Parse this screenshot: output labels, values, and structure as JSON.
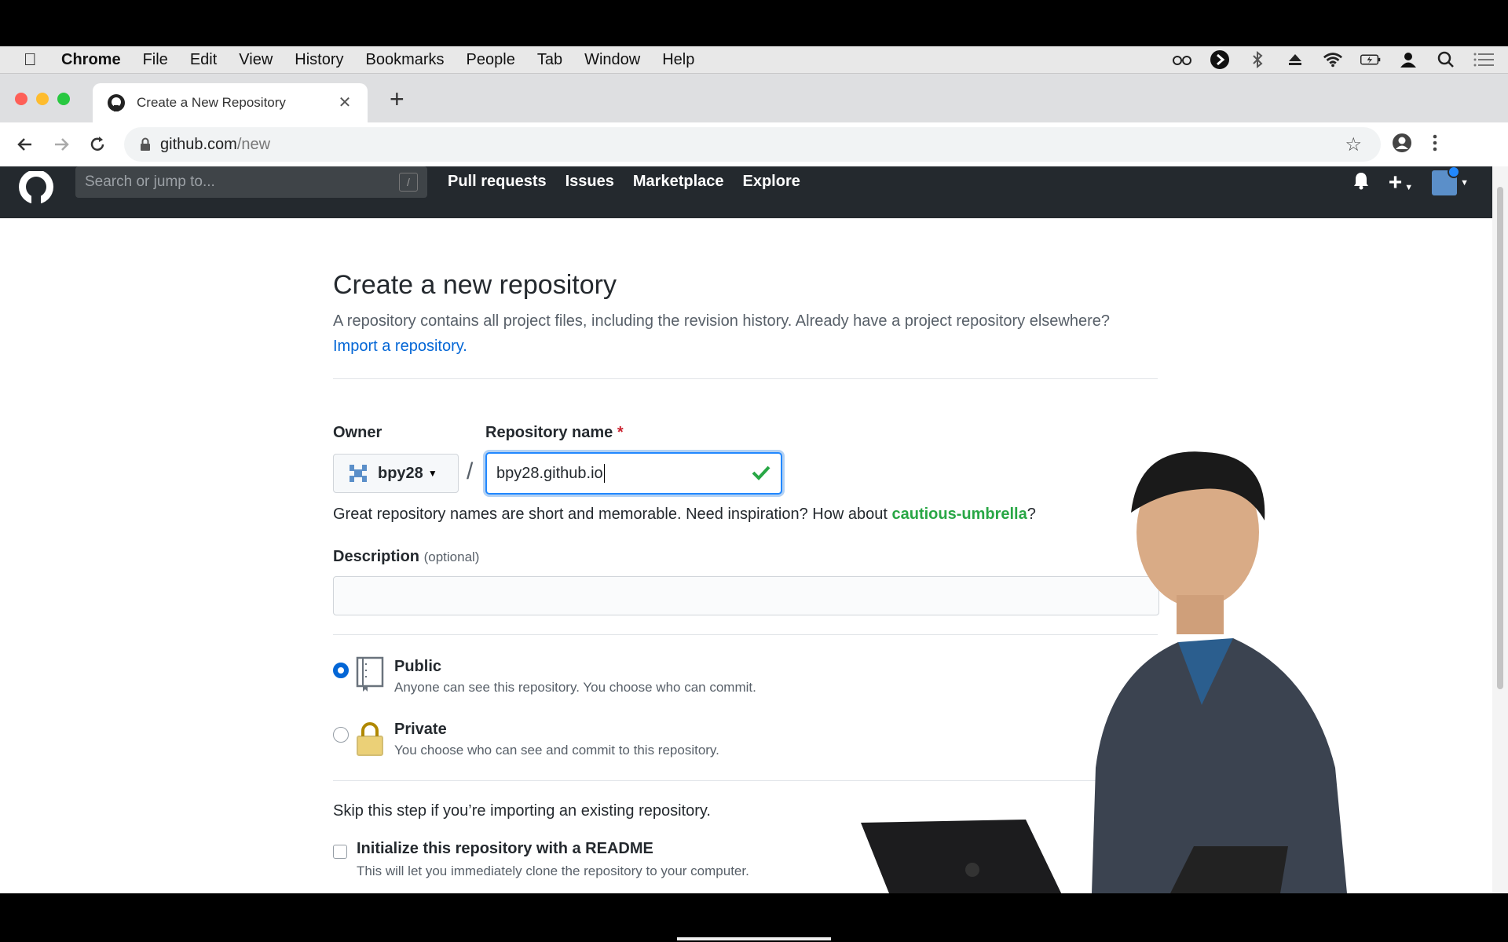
{
  "mac_menu": {
    "app": "Chrome",
    "items": [
      "File",
      "Edit",
      "View",
      "History",
      "Bookmarks",
      "People",
      "Tab",
      "Window",
      "Help"
    ],
    "status_icons": [
      "glasses-icon",
      "play-circle-icon",
      "bluetooth-icon",
      "eject-icon",
      "wifi-icon",
      "battery-icon",
      "user-icon",
      "search-icon",
      "list-icon"
    ]
  },
  "browser": {
    "tab_title": "Create a New Repository",
    "url_host": "github.com",
    "url_path": "/new"
  },
  "gh_header": {
    "search_placeholder": "Search or jump to...",
    "search_shortcut": "/",
    "nav": [
      "Pull requests",
      "Issues",
      "Marketplace",
      "Explore"
    ],
    "plus_label": "+"
  },
  "form": {
    "title": "Create a new repository",
    "subtitle": "A repository contains all project files, including the revision history. Already have a project repository elsewhere?",
    "import_link": "Import a repository.",
    "owner_label": "Owner",
    "owner_value": "bpy28",
    "separator": "/",
    "repo_label": "Repository name",
    "required_mark": "*",
    "repo_value": "bpy28.github.io",
    "hint_prefix": "Great repository names are short and memorable. Need inspiration? How about ",
    "hint_suggestion": "cautious-umbrella",
    "hint_suffix": "?",
    "description_label": "Description",
    "description_optional": "(optional)",
    "description_value": "",
    "visibility": [
      {
        "title": "Public",
        "note": "Anyone can see this repository. You choose who can commit.",
        "selected": true
      },
      {
        "title": "Private",
        "note": "You choose who can see and commit to this repository.",
        "selected": false
      }
    ],
    "skip_text": "Skip this step if you’re importing an existing repository.",
    "readme_label": "Initialize this repository with a README",
    "readme_note": "This will let you immediately clone the repository to your computer."
  },
  "colors": {
    "gh_header_bg": "#24292e",
    "link_blue": "#0366d6",
    "success_green": "#28a745"
  }
}
